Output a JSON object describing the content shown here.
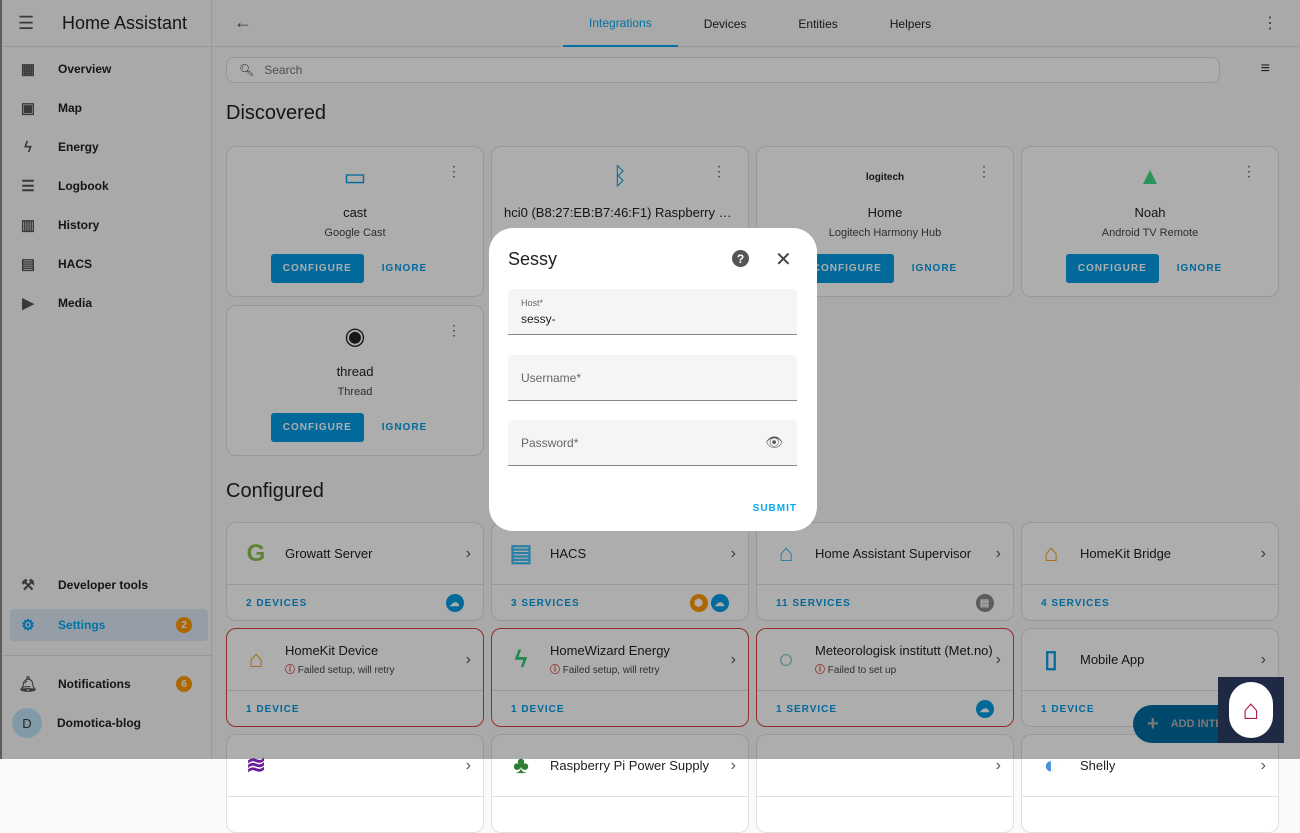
{
  "sidebar": {
    "title": "Home Assistant",
    "items": [
      {
        "label": "Overview",
        "icon": "▦"
      },
      {
        "label": "Map",
        "icon": "▣"
      },
      {
        "label": "Energy",
        "icon": "ϟ"
      },
      {
        "label": "Logbook",
        "icon": "☰"
      },
      {
        "label": "History",
        "icon": "▥"
      },
      {
        "label": "HACS",
        "icon": "▤"
      },
      {
        "label": "Media",
        "icon": "▶"
      }
    ],
    "developer_tools": "Developer tools",
    "settings": "Settings",
    "settings_badge": "2",
    "notifications": "Notifications",
    "notifications_badge": "6",
    "user": "Domotica-blog",
    "user_initial": "D"
  },
  "header": {
    "tabs": [
      "Integrations",
      "Devices",
      "Entities",
      "Helpers"
    ]
  },
  "search": {
    "placeholder": "Search"
  },
  "discovered": {
    "title": "Discovered",
    "configure": "CONFIGURE",
    "ignore": "IGNORE",
    "cards": [
      {
        "name": "cast",
        "sub": "Google Cast",
        "icon": "▭",
        "color": "#039be5"
      },
      {
        "name": "hci0 (B8:27:EB:B7:46:F1) Raspberry Pi...",
        "sub": "",
        "icon": "ᛒ",
        "color": "#039be5"
      },
      {
        "name": "Home",
        "sub": "Logitech Harmony Hub",
        "icon": "logitech",
        "color": "#222"
      },
      {
        "name": "Noah",
        "sub": "Android TV Remote",
        "icon": "▲",
        "color": "#3ddc84"
      },
      {
        "name": "thread",
        "sub": "Thread",
        "icon": "◉",
        "color": "#222"
      }
    ]
  },
  "configured": {
    "title": "Configured",
    "cards": [
      {
        "name": "Growatt Server",
        "footer": "2 DEVICES",
        "icon": "G",
        "color": "#8bc34a",
        "error": "",
        "badges": [
          "☁"
        ]
      },
      {
        "name": "HACS",
        "footer": "3 SERVICES",
        "icon": "▤",
        "color": "#41bdf5",
        "error": "",
        "badges": [
          "⬢",
          "☁"
        ]
      },
      {
        "name": "Home Assistant Supervisor",
        "footer": "11 SERVICES",
        "icon": "⌂",
        "color": "#41bdf5",
        "error": "",
        "badges": [
          "▤"
        ]
      },
      {
        "name": "HomeKit Bridge",
        "footer": "4 SERVICES",
        "icon": "⌂",
        "color": "#f5a623",
        "error": "",
        "badges": []
      },
      {
        "name": "HomeKit Device",
        "footer": "1 DEVICE",
        "icon": "⌂",
        "color": "#f5a623",
        "error": "Failed setup, will retry",
        "badges": []
      },
      {
        "name": "HomeWizard Energy",
        "footer": "1 DEVICE",
        "icon": "ϟ",
        "color": "#2ecc71",
        "error": "Failed setup, will retry",
        "badges": []
      },
      {
        "name": "Meteorologisk institutt (Met.no)",
        "footer": "1 SERVICE",
        "icon": "◌",
        "color": "#1a7f8e",
        "error": "Failed to set up",
        "badges": [
          "☁"
        ]
      },
      {
        "name": "Mobile App",
        "footer": "1 DEVICE",
        "icon": "▯",
        "color": "#039be5",
        "error": "",
        "badges": []
      },
      {
        "name": "",
        "footer": "",
        "icon": "≋",
        "color": "#6a1b9a",
        "error": "",
        "badges": []
      },
      {
        "name": "Raspberry Pi Power Supply",
        "footer": "",
        "icon": "♣",
        "color": "#2e7d32",
        "error": "",
        "badges": []
      },
      {
        "name": "",
        "footer": "",
        "icon": "",
        "color": "#999",
        "error": "",
        "badges": []
      },
      {
        "name": "Shelly",
        "footer": "",
        "icon": "◐",
        "color": "#4a90d9",
        "error": "",
        "badges": []
      }
    ]
  },
  "fab": {
    "label": "ADD INTEGRATION"
  },
  "dialog": {
    "title": "Sessy",
    "host_label": "Host*",
    "host_value": "sessy-",
    "username_label": "Username*",
    "password_label": "Password*",
    "submit": "SUBMIT"
  }
}
